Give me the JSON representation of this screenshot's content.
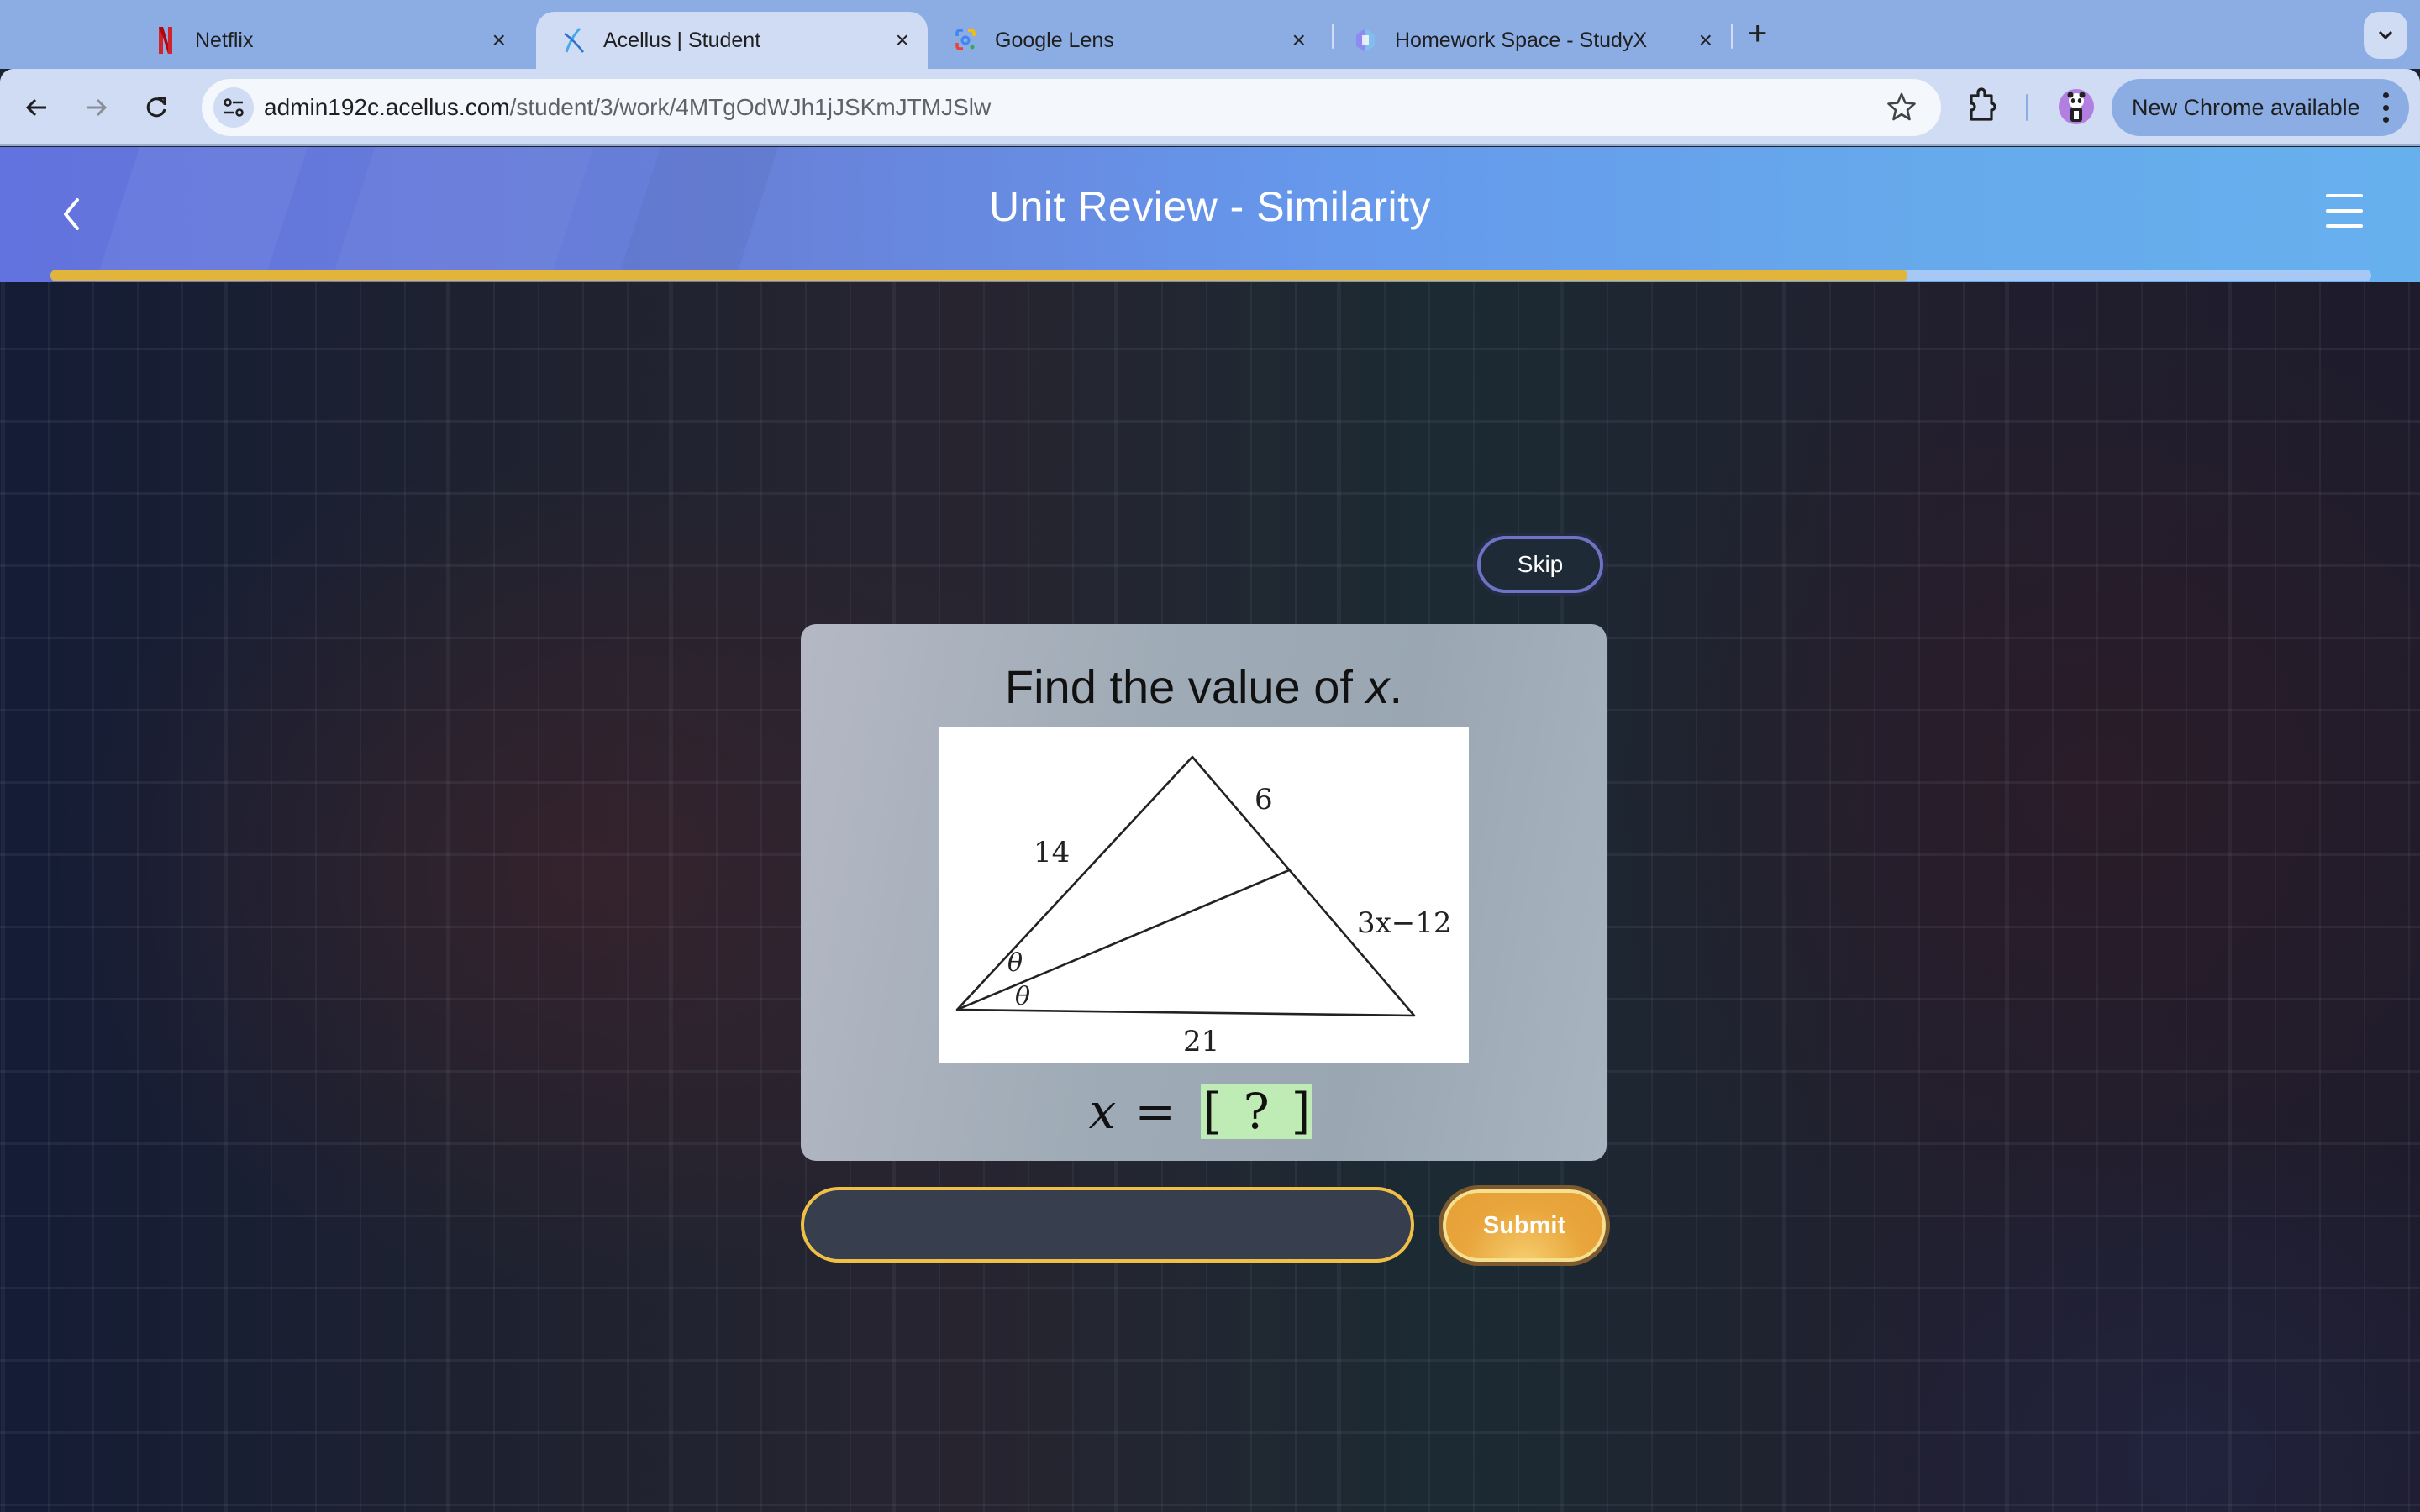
{
  "browser": {
    "tabs": [
      {
        "title": "Netflix",
        "icon": "netflix-icon",
        "active": false
      },
      {
        "title": "Acellus | Student",
        "icon": "acellus-icon",
        "active": true
      },
      {
        "title": "Google Lens",
        "icon": "google-lens-icon",
        "active": false
      },
      {
        "title": "Homework Space - StudyX",
        "icon": "studyx-icon",
        "active": false
      }
    ],
    "new_tab_label": "+",
    "close_glyph": "×",
    "url_host": "admin192c.acellus.com",
    "url_path": "/student/3/work/4MTgOdWJh1jJSKmJTMJSlw",
    "update_chip_label": "New Chrome available"
  },
  "app": {
    "title": "Unit Review - Similarity",
    "progress_fraction": 0.8,
    "colors": {
      "progress_fill": "#e1b43c",
      "progress_track": "#a5c9f4",
      "submit": "#e9a63c",
      "input_border": "#efbf48",
      "answer_blank": "#bfecb4"
    }
  },
  "question": {
    "skip_label": "Skip",
    "prompt_prefix": "Find the value of ",
    "prompt_var": "x",
    "prompt_suffix": ".",
    "figure": {
      "labels": {
        "left_side": "14",
        "right_upper": "6",
        "right_lower": "3x−12",
        "base": "21",
        "angle_upper": "θ",
        "angle_lower": "θ"
      }
    },
    "answer_var": "x",
    "answer_eq": "=",
    "answer_open": "[",
    "answer_placeholder": "?",
    "answer_close": "]"
  },
  "answer_form": {
    "input_value": "",
    "submit_label": "Submit"
  }
}
